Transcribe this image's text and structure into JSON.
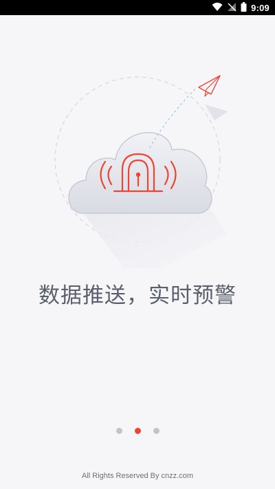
{
  "status_bar": {
    "time": "9:09",
    "icons": [
      "wifi-icon",
      "signal-off-icon",
      "battery-icon"
    ]
  },
  "onboarding": {
    "headline": "数据推送，实时预警",
    "illustration_icons": [
      "cloud-icon",
      "alarm-icon",
      "paper-plane-icon"
    ],
    "pages_total": 3,
    "current_page": 2,
    "accent_color": "#ee4433"
  },
  "footer": {
    "text": "All Rights Reserved By cnzz.com"
  },
  "colors": {
    "background": "#f6f6f9",
    "headline": "#5a5f6c",
    "dot_inactive": "#c4c4c8",
    "dot_active": "#ee4433"
  }
}
